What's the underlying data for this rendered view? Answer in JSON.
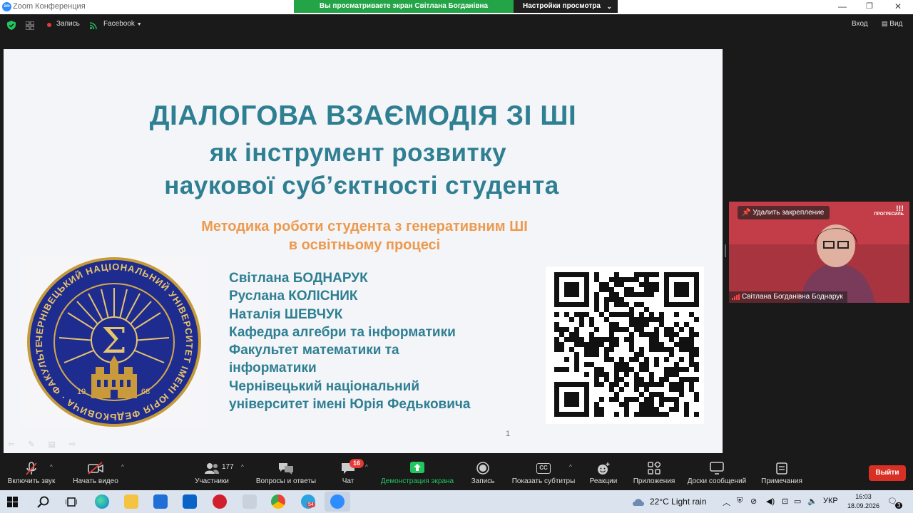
{
  "window": {
    "title": "Zoom Конференция",
    "app_icon": "zm"
  },
  "share_banner": {
    "message": "Вы просматриваете экран Світлана Богданівна Боднарук",
    "options": "Настройки просмотра"
  },
  "toolbar": {
    "record": "Запись",
    "stream": "Facebook",
    "signin": "Вход",
    "view": "Вид"
  },
  "slide": {
    "title": "ДІАЛОГОВА ВЗАЄМОДІЯ ЗІ ШІ",
    "subtitle_line1": "як інструмент розвитку",
    "subtitle_line2": "наукової суб’єктності студента",
    "method_line1": "Методика роботи студента з генеративним ШІ",
    "method_line2": "в освітньому процесі",
    "authors": [
      "Світлана БОДНАРУК",
      "Руслана КОЛІСНИК",
      "Наталія ШЕВЧУК",
      "Кафедра алгебри та інформатики",
      "Факультет математики та",
      "інформатики",
      "Чернівецький національний",
      "університет імені Юрія Федьковича"
    ],
    "seal_text": "ЧЕРНІВЕЦЬКИЙ НАЦІОНАЛЬНИЙ УНІВЕРСИТЕТ ІМЕНІ ЮРІЯ ФЕДЬКОВИЧА · ФАКУЛЬТЕТ МАТЕМАТИКИ ТА ІНФОРМАТИКИ",
    "seal_year_left": "19",
    "seal_year_right": "68",
    "page_number": "1"
  },
  "video": {
    "unpin": "Удалить закрепление",
    "participant": "Світлана Богданівна Боднарук",
    "brand_mark": "ПРОГРЕСИЛЬ"
  },
  "controls": {
    "mute": "Включить звук",
    "video": "Начать видео",
    "participants": "Участники",
    "participants_count": "177",
    "qa": "Вопросы и ответы",
    "chat": "Чат",
    "chat_badge": "16",
    "share": "Демонстрация экрана",
    "record": "Запись",
    "captions": "Показать субтитры",
    "captions_icon": "CC",
    "reactions": "Реакции",
    "apps": "Приложения",
    "whiteboards": "Доски сообщений",
    "notes": "Примечания",
    "leave": "Выйти"
  },
  "taskbar": {
    "weather": "22°C  Light rain",
    "language": "УКР",
    "time": "16:03",
    "date": "18.09.2026",
    "notif_count": "3",
    "telegram_badge": "54"
  },
  "colors": {
    "title_teal": "#2f7f93",
    "method_orange": "#ed9a4e",
    "share_green": "#22a447",
    "leave_red": "#d93025",
    "zoom_blue": "#2d8cff"
  }
}
